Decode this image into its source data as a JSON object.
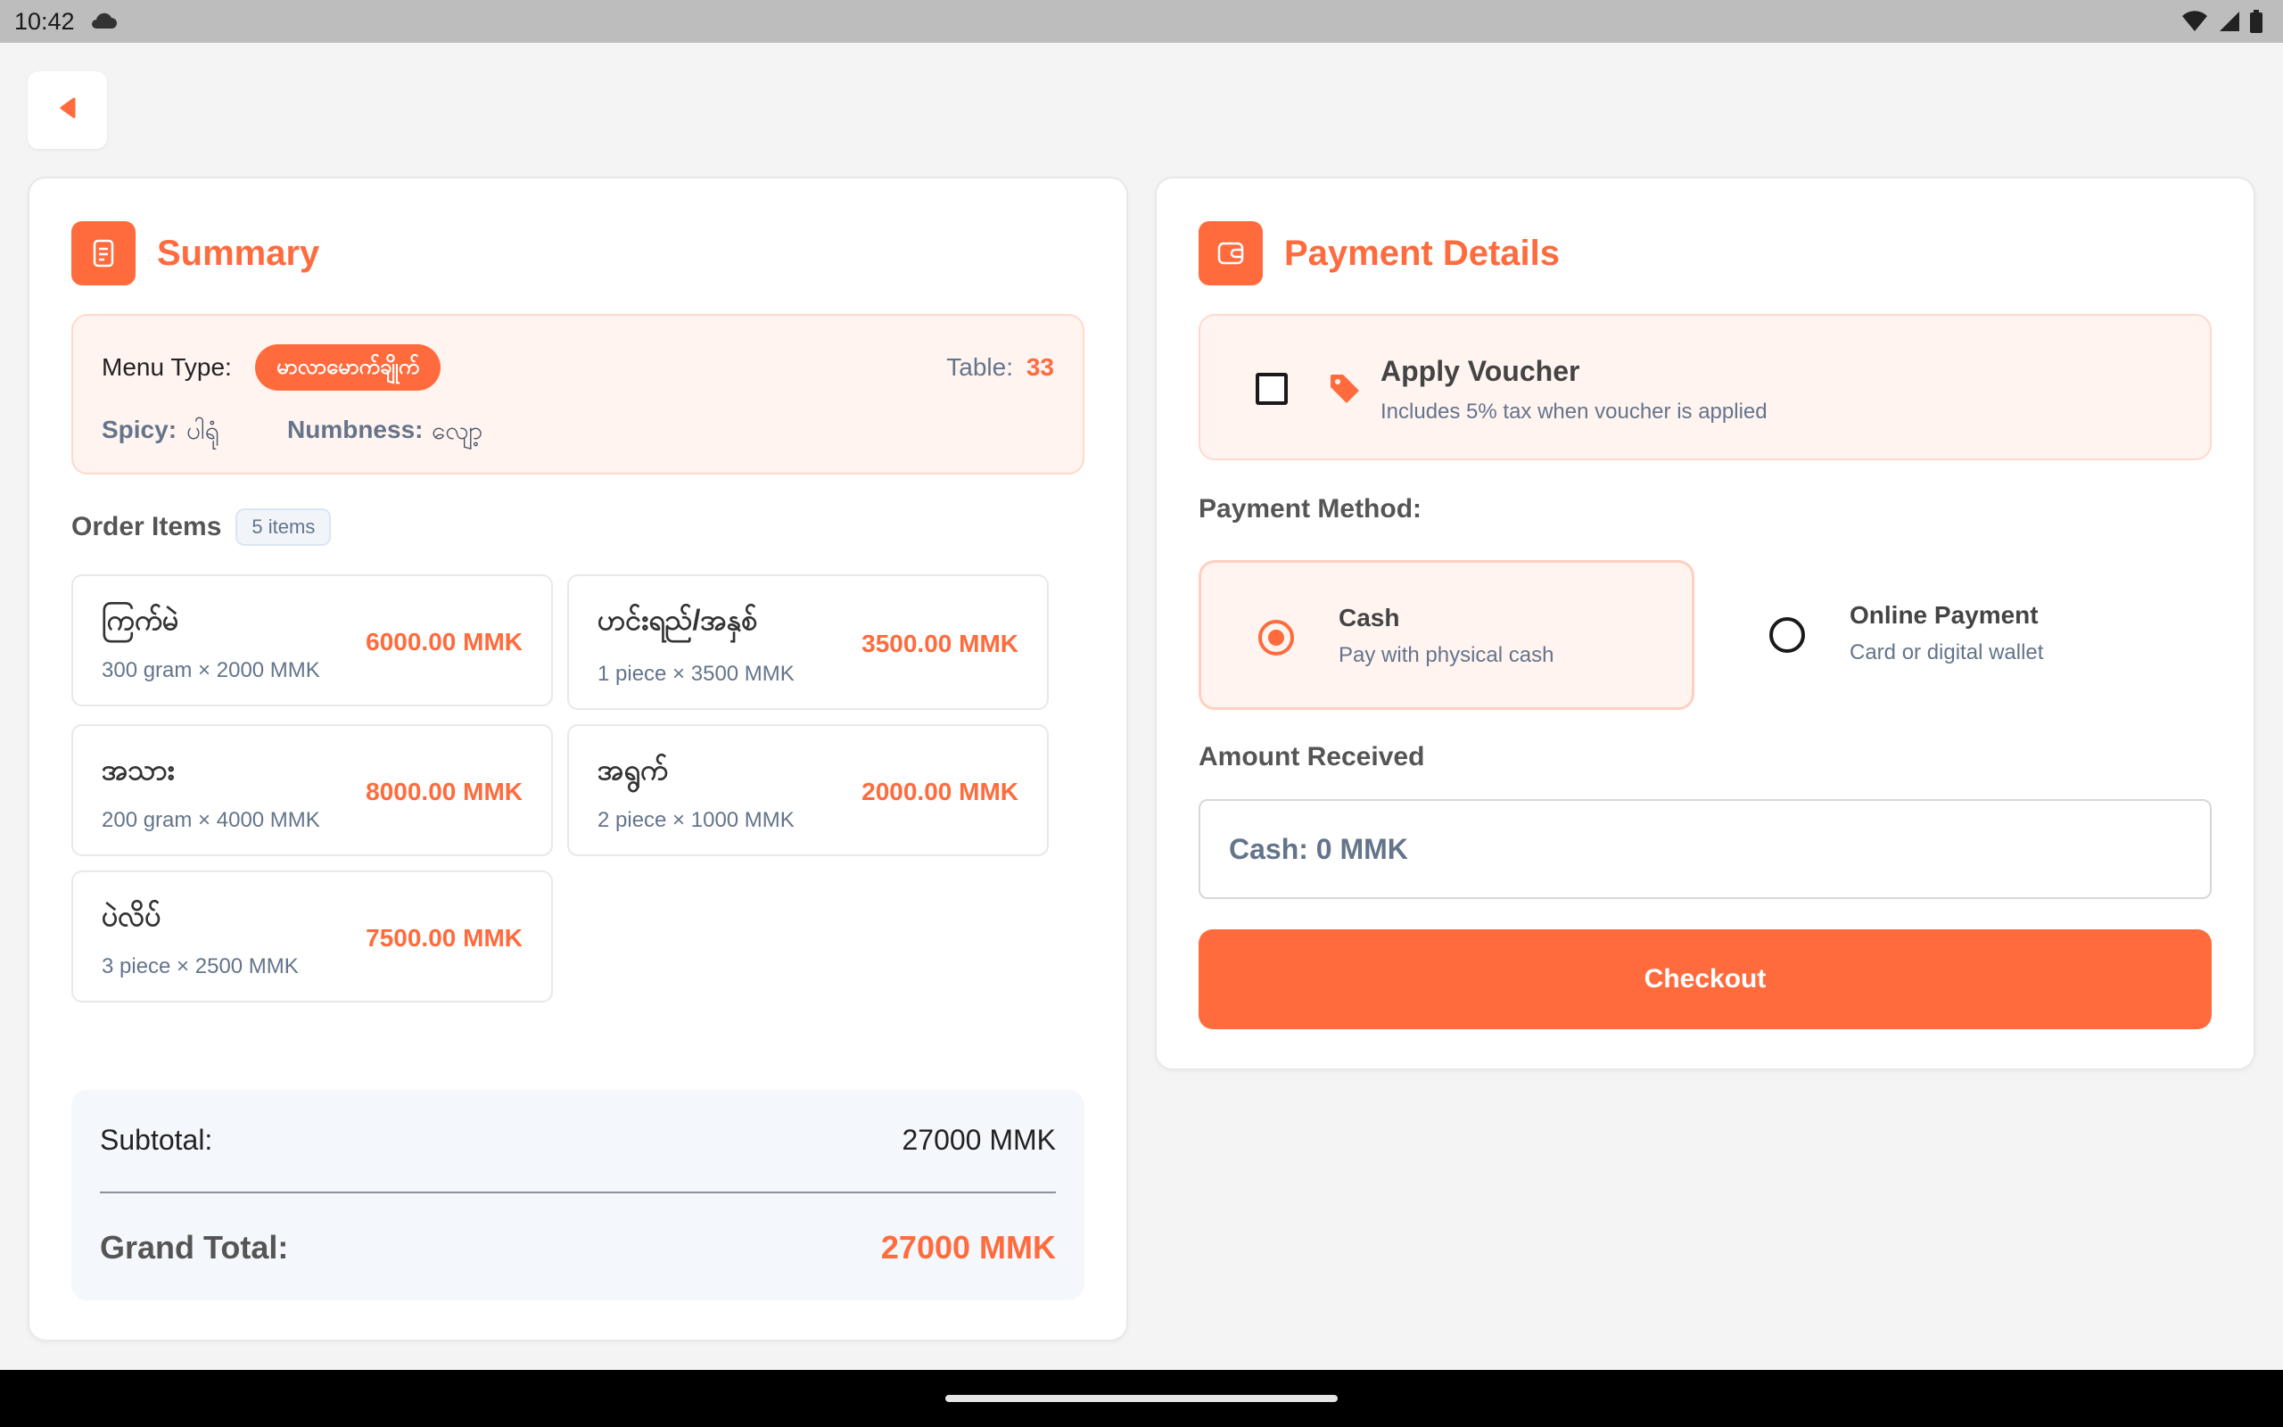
{
  "status_bar": {
    "time": "10:42"
  },
  "summary": {
    "title": "Summary",
    "menu_type_label": "Menu Type:",
    "menu_type_value": "မာလာမောက်ချိုက်",
    "table_label": "Table:",
    "table_value": "33",
    "spicy_label": "Spicy:",
    "spicy_value": "ပါရုံ",
    "numbness_label": "Numbness:",
    "numbness_value": "လျော့",
    "order_items_label": "Order Items",
    "item_count": "5 items",
    "items": [
      {
        "name": "ကြက်မဲ",
        "detail": "300 gram × 2000 MMK",
        "price": "6000.00 MMK"
      },
      {
        "name": "ဟင်းရည်/အနှစ်",
        "detail": "1 piece × 3500 MMK",
        "price": "3500.00 MMK"
      },
      {
        "name": "အသား",
        "detail": "200 gram × 4000 MMK",
        "price": "8000.00 MMK"
      },
      {
        "name": "အရွက်",
        "detail": "2 piece × 1000 MMK",
        "price": "2000.00 MMK"
      },
      {
        "name": "ပဲလိပ်",
        "detail": "3 piece × 2500 MMK",
        "price": "7500.00 MMK"
      }
    ],
    "subtotal_label": "Subtotal:",
    "subtotal_value": "27000 MMK",
    "grand_total_label": "Grand Total:",
    "grand_total_value": "27000 MMK"
  },
  "payment": {
    "title": "Payment Details",
    "voucher_title": "Apply Voucher",
    "voucher_subtitle": "Includes 5% tax when voucher is applied",
    "voucher_checked": false,
    "method_label": "Payment Method:",
    "methods": [
      {
        "title": "Cash",
        "subtitle": "Pay with physical cash",
        "selected": true
      },
      {
        "title": "Online Payment",
        "subtitle": "Card or digital wallet",
        "selected": false
      }
    ],
    "amount_label": "Amount Received",
    "amount_placeholder": "Cash: 0 MMK",
    "checkout_label": "Checkout"
  },
  "colors": {
    "accent": "#ff6b3d",
    "accent_light": "#fff4f0",
    "muted_text": "#64748b"
  },
  "icons": [
    "cloud-icon",
    "wifi-icon",
    "signal-icon",
    "battery-icon",
    "back-arrow-icon",
    "receipt-icon",
    "wallet-icon",
    "tag-icon"
  ]
}
